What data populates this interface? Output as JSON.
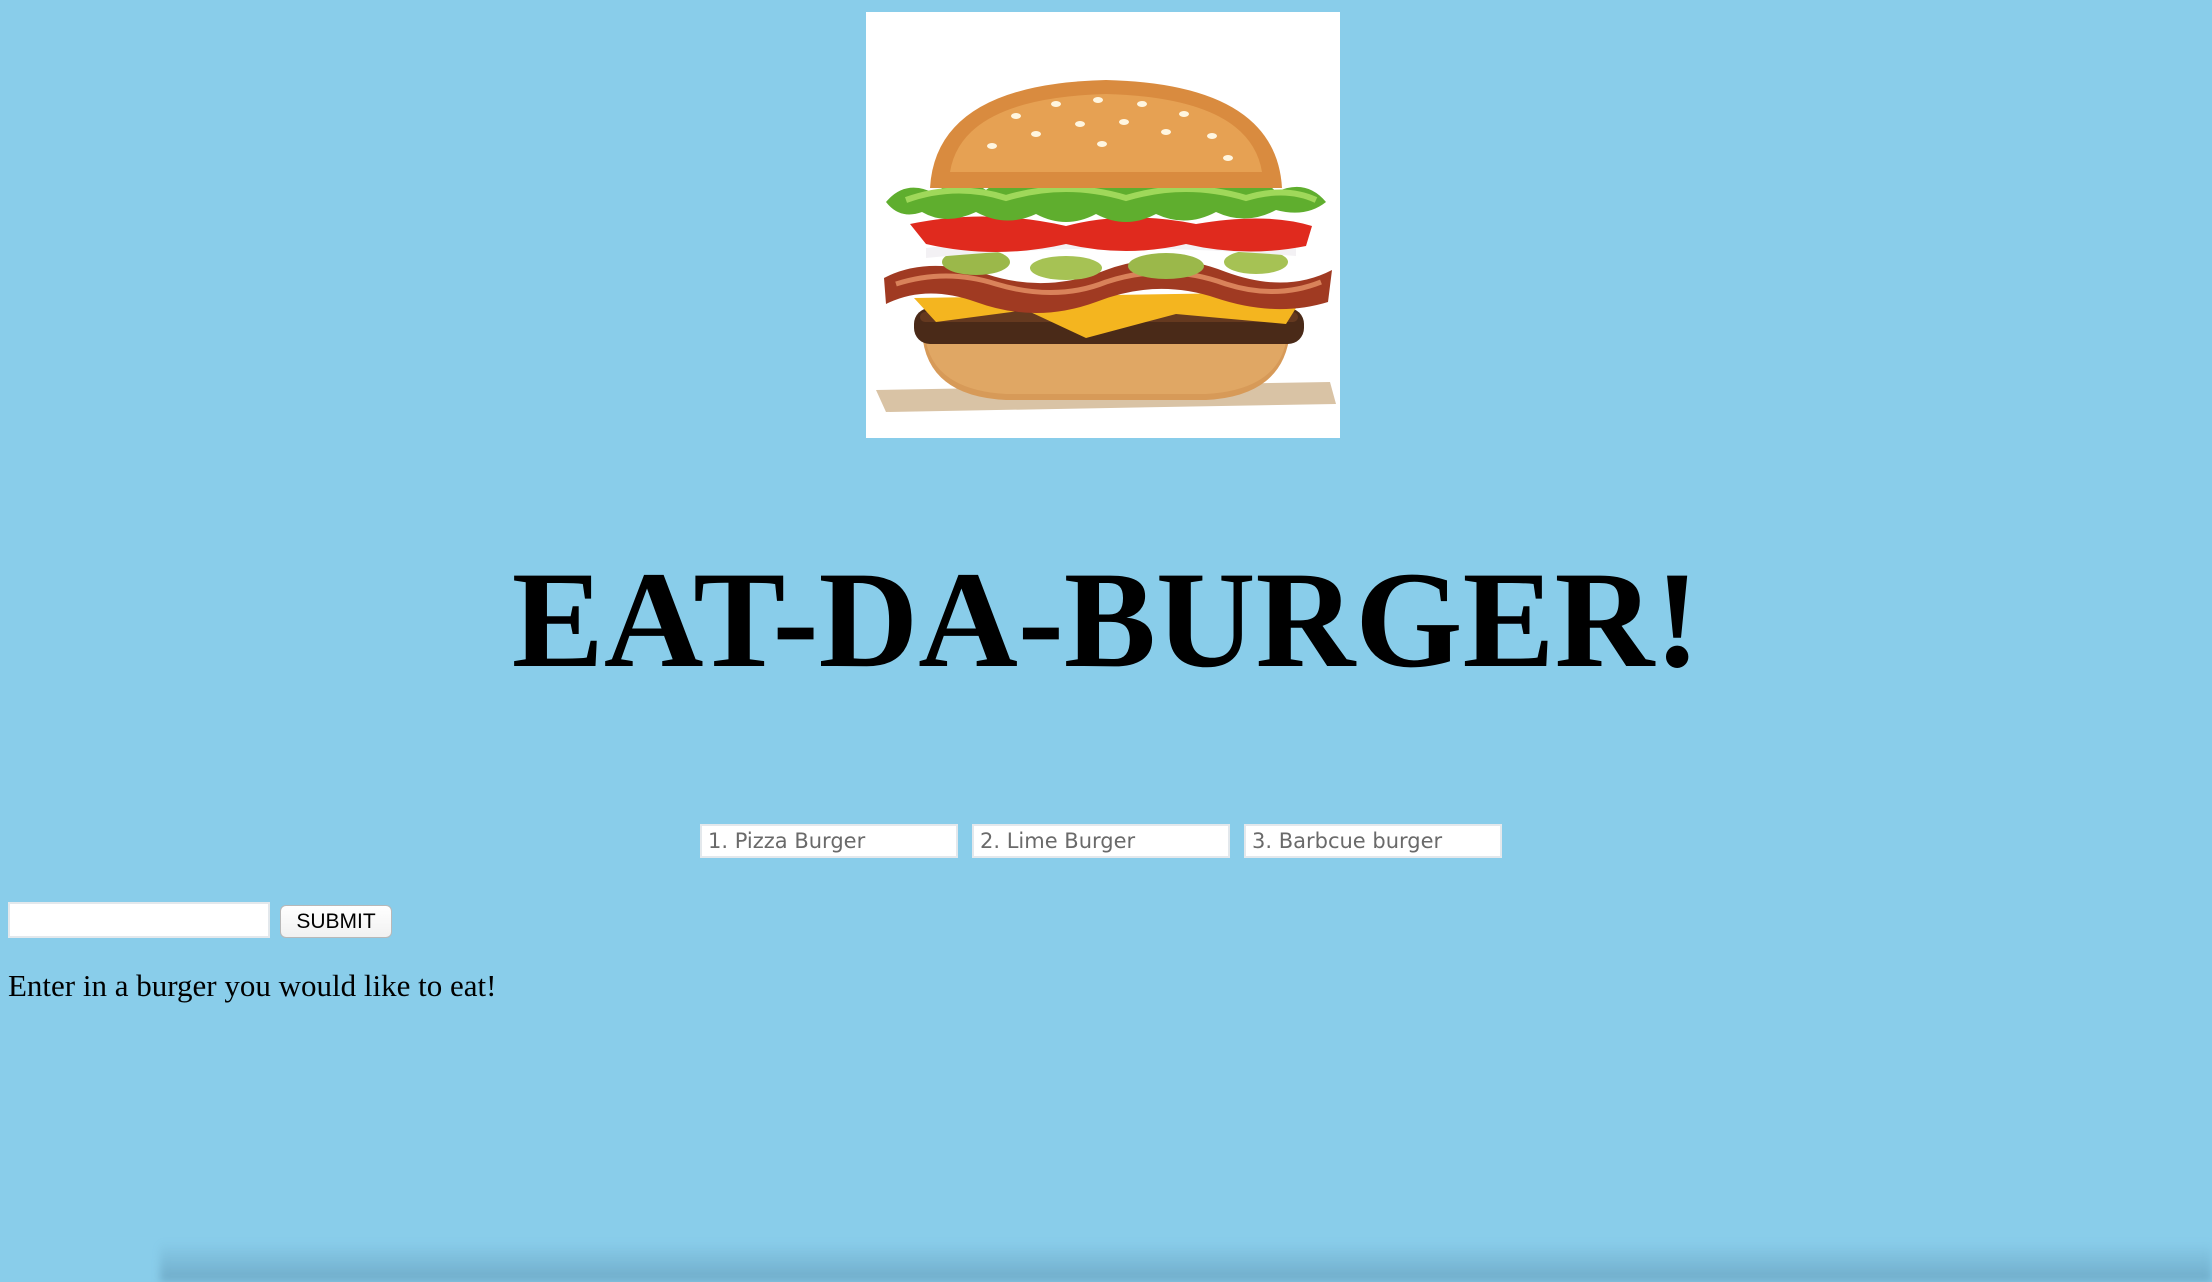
{
  "header": {
    "title": "EAT-DA-BURGER!",
    "image_icon": "burger-photo"
  },
  "burgers": [
    {
      "placeholder": "1. Pizza Burger"
    },
    {
      "placeholder": "2. Lime Burger"
    },
    {
      "placeholder": "3. Barbcue burger"
    }
  ],
  "form": {
    "input_value": "",
    "submit_label": "SUBMIT",
    "hint": "Enter in a burger you would like to eat!"
  },
  "colors": {
    "background": "#89cdea"
  }
}
